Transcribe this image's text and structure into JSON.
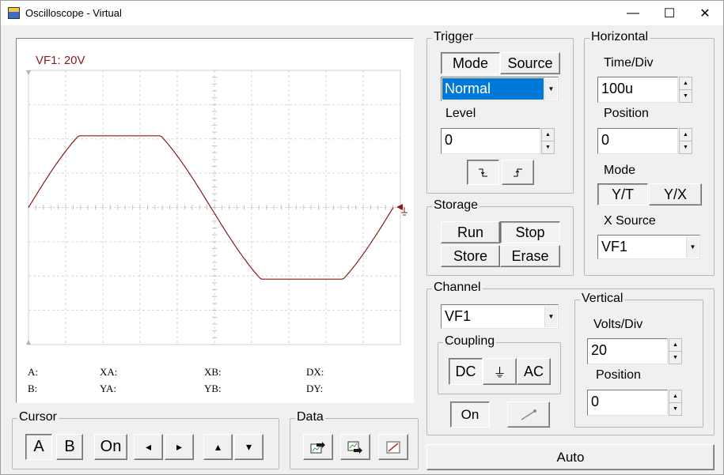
{
  "window": {
    "title": "Oscilloscope - Virtual",
    "minimize": "—",
    "maximize": "☐",
    "close": "✕"
  },
  "scope": {
    "channel_label": "VF1: 20V",
    "trace_color": "#8b1a1a",
    "readouts": {
      "A": "A:",
      "B": "B:",
      "XA": "XA:",
      "YA": "YA:",
      "XB": "XB:",
      "YB": "YB:",
      "DX": "DX:",
      "DY": "DY:"
    }
  },
  "trigger": {
    "label": "Trigger",
    "mode_label": "Mode",
    "source_label": "Source",
    "mode_value": "Normal",
    "level_label": "Level",
    "level_value": "0",
    "falling_edge_icon": "falling-edge-icon",
    "rising_edge_icon": "rising-edge-icon"
  },
  "horizontal": {
    "label": "Horizontal",
    "time_div_label": "Time/Div",
    "time_div_value": "100u",
    "position_label": "Position",
    "position_value": "0",
    "mode_label": "Mode",
    "mode_yt": "Y/T",
    "mode_yx": "Y/X",
    "xsource_label": "X Source",
    "xsource_value": "VF1"
  },
  "storage": {
    "label": "Storage",
    "run": "Run",
    "stop": "Stop",
    "store": "Store",
    "erase": "Erase"
  },
  "channel": {
    "label": "Channel",
    "value": "VF1",
    "coupling_label": "Coupling",
    "dc": "DC",
    "gnd": "⏚",
    "ac": "AC",
    "on": "On"
  },
  "vertical": {
    "label": "Vertical",
    "volts_div_label": "Volts/Div",
    "volts_div_value": "20",
    "position_label": "Position",
    "position_value": "0"
  },
  "cursor": {
    "label": "Cursor",
    "a": "A",
    "b": "B",
    "on": "On",
    "left": "◂",
    "right": "▸",
    "up": "▴",
    "down": "▾"
  },
  "data": {
    "label": "Data"
  },
  "auto": "Auto"
}
